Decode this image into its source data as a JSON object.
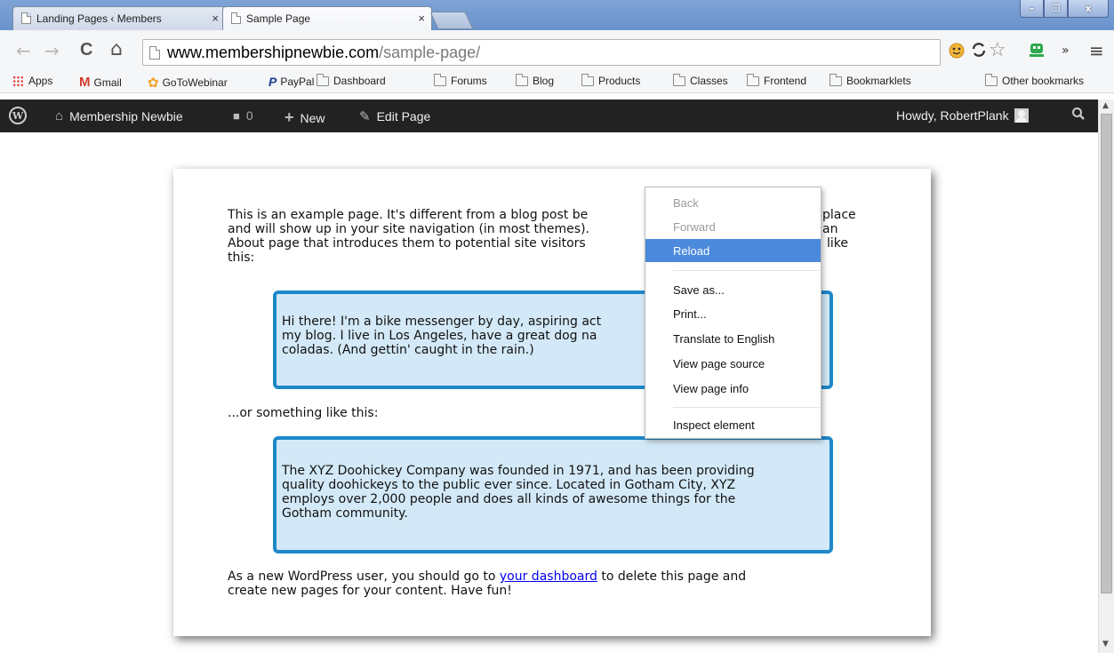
{
  "tabs": [
    {
      "title": "Landing Pages ‹ Members",
      "close": "×",
      "active": false
    },
    {
      "title": "Sample Page",
      "close": "×",
      "active": true
    }
  ],
  "window_controls": {
    "minimize": "–",
    "maximize": "❐",
    "close": "x"
  },
  "toolbar": {
    "back": "←",
    "forward": "→",
    "reload": "C",
    "home": "⌂",
    "url_domain": "www.membershipnewbie.com",
    "url_path": "/sample-page/",
    "star": "☆",
    "chevrons": "»",
    "menu": "≡"
  },
  "bookmarks": {
    "items": [
      "Apps",
      "Gmail",
      "GoToWebinar",
      "PayPal",
      "Dashboard",
      "Forums",
      "Blog",
      "Products",
      "Classes",
      "Frontend",
      "Bookmarklets"
    ],
    "other": "Other bookmarks"
  },
  "wp_admin_bar": {
    "logo": "W",
    "site_name": "Membership Newbie",
    "comments_count": "0",
    "new_label": "New",
    "edit_label": "Edit Page",
    "howdy": "Howdy, RobertPlank"
  },
  "page": {
    "intro_lines": [
      "This is an example page. It's different from a blog post be",
      "and will show up in your site navigation (in most themes).",
      "About page that introduces them to potential site visitors",
      "this:"
    ],
    "intro_right_fragments": [
      "place",
      "an",
      "like"
    ],
    "quote1_lines": [
      "Hi there! I'm a bike messenger by day, aspiring act",
      "my blog. I live in Los Angeles, have a great dog na",
      "coladas. (And gettin' caught in the rain.)"
    ],
    "middle": "...or something like this:",
    "quote2_lines": [
      "The XYZ Doohickey Company was founded in 1971, and has been providing",
      "quality doohickeys to the public ever since. Located in Gotham City, XYZ",
      "employs over 2,000 people and does all kinds of awesome things for the",
      "Gotham community."
    ],
    "outro_prefix": "As a new WordPress user, you should go to ",
    "outro_link": "your dashboard",
    "outro_suffix": " to delete this page and",
    "outro_line2": "create new pages for your content. Have fun!"
  },
  "context_menu": {
    "items": [
      {
        "label": "Back",
        "state": "disabled"
      },
      {
        "label": "Forward",
        "state": "disabled"
      },
      {
        "label": "Reload",
        "state": "highlighted"
      },
      {
        "label": "Save as...",
        "state": "enabled"
      },
      {
        "label": "Print...",
        "state": "enabled"
      },
      {
        "label": "Translate to English",
        "state": "enabled"
      },
      {
        "label": "View page source",
        "state": "enabled"
      },
      {
        "label": "View page info",
        "state": "enabled"
      },
      {
        "label": "Inspect element",
        "state": "enabled"
      }
    ]
  },
  "colors": {
    "accent_blue": "#1e88c8",
    "callout_bg": "#d3e9f7",
    "admin_bar": "#222222",
    "menu_highlight": "#4b89dc",
    "link": "#0000ee"
  }
}
